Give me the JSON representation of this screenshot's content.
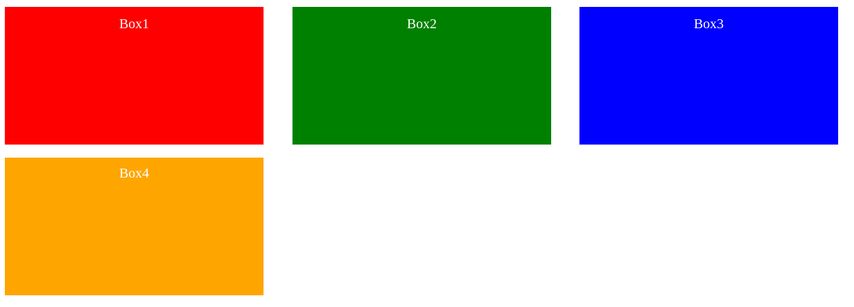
{
  "boxes": [
    {
      "label": "Box1",
      "color": "#ff0000"
    },
    {
      "label": "Box2",
      "color": "#008000"
    },
    {
      "label": "Box3",
      "color": "#0000ff"
    },
    {
      "label": "Box4",
      "color": "#ffa500"
    }
  ]
}
